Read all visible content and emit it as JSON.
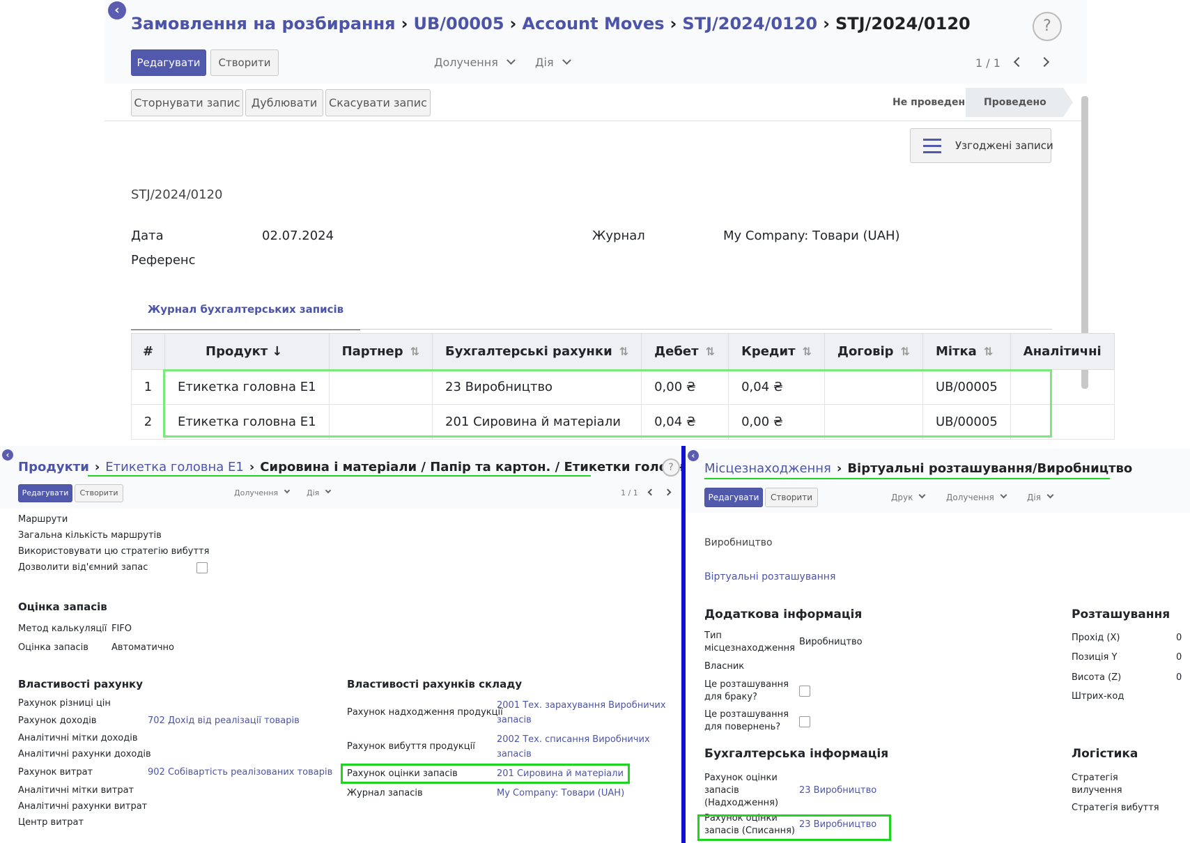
{
  "top": {
    "breadcrumb": [
      "Замовлення на розбирання",
      "UB/00005",
      "Account Moves",
      "STJ/2024/0120"
    ],
    "current": "STJ/2024/0120",
    "edit_btn": "Редагувати",
    "create_btn": "Створити",
    "attach_dd": "Долучення",
    "action_dd": "Дія",
    "pager": "1 / 1",
    "help": "?",
    "reverse_btn": "Сторнувати запис",
    "duplicate_btn": "Дублювати",
    "cancel_btn": "Скасувати запис",
    "stage_draft": "Не проведено",
    "stage_posted": "Проведено",
    "smart_btn": "Узгоджені записи",
    "record_name": "STJ/2024/0120",
    "date_label": "Дата",
    "date_value": "02.07.2024",
    "journal_label": "Журнал",
    "journal_value": "My Company: Товари (UAH)",
    "ref_label": "Референс",
    "tab_label": "Журнал бухгалтерських записів",
    "columns": [
      "#",
      "Продукт",
      "Партнер",
      "Бухгалтерські рахунки",
      "Дебет",
      "Кредит",
      "Договір",
      "Мітка",
      "Аналітичні"
    ],
    "rows": [
      {
        "n": "1",
        "product": "Етикетка головна E1",
        "partner": "",
        "account": "23 Виробництво",
        "debit": "0,00 ₴",
        "credit": "0,04 ₴",
        "contract": "",
        "label": "UB/00005",
        "analytic": ""
      },
      {
        "n": "2",
        "product": "Етикетка головна E1",
        "partner": "",
        "account": "201 Сировина й матеріали",
        "debit": "0,04 ₴",
        "credit": "0,00 ₴",
        "contract": "",
        "label": "UB/00005",
        "analytic": ""
      }
    ]
  },
  "left": {
    "crumb_root": "Продукти",
    "crumb_product": "Етикетка головна E1",
    "crumb_cat": "Сировина і матеріали / Папір та картон. / Етикетки головні",
    "edit_btn": "Редагувати",
    "create_btn": "Створити",
    "attach_dd": "Долучення",
    "action_dd": "Дія",
    "pager": "1 / 1",
    "help": "?",
    "routes": "Маршрути",
    "routes_count": "Загальна кількість маршрутів",
    "use_strategy": "Використовувати цю стратегію вибуття",
    "allow_negative": "Дозволити від'ємний запас",
    "valuation_title": "Оцінка запасів",
    "cost_method_label": "Метод калькуляції",
    "cost_method_value": "FIFO",
    "valuation_label": "Оцінка запасів",
    "valuation_value": "Автоматично",
    "acc_props_title": "Властивості рахунку",
    "price_diff": "Рахунок різниці цін",
    "income_acc": "Рахунок доходів",
    "income_acc_value": "702 Дохід від реалізації товарів",
    "income_tags": "Аналітичні мітки доходів",
    "income_analytic": "Аналітичні рахунки доходів",
    "expense_acc": "Рахунок витрат",
    "expense_acc_value": "902 Собівартість реалізованих товарів",
    "expense_tags": "Аналітичні мітки витрат",
    "expense_analytic": "Аналітичні рахунки витрат",
    "cost_center": "Центр витрат",
    "stock_props_title": "Властивості рахунків складу",
    "in_acc": "Рахунок надходження продукції",
    "in_acc_value1": "2001 Тех. зарахування Виробничих",
    "in_acc_value2": "запасів",
    "out_acc": "Рахунок вибуття продукції",
    "out_acc_value1": "2002 Тех. списання Виробничих",
    "out_acc_value2": "запасів",
    "val_acc": "Рахунок оцінки запасів",
    "val_acc_value": "201 Сировина й матеріали",
    "stock_journal": "Журнал запасів",
    "stock_journal_value": "My Company: Товари (UAH)"
  },
  "right": {
    "crumb_root": "Місцезнаходження",
    "crumb_current": "Віртуальні розташування/Виробництво",
    "edit_btn": "Редагувати",
    "create_btn": "Створити",
    "print_dd": "Друк",
    "attach_dd": "Долучення",
    "action_dd": "Дія",
    "name": "Виробництво",
    "parent": "Віртуальні розташування",
    "extra_title": "Додаткова інформація",
    "type_label1": "Тип",
    "type_label2": "місцезнаходження",
    "type_value": "Виробництво",
    "owner": "Власник",
    "scrap1": "Це розташування",
    "scrap2": "для браку?",
    "return1": "Це розташування",
    "return2": "для повернень?",
    "acc_title": "Бухгалтерська інформація",
    "in_label1": "Рахунок оцінки",
    "in_label2": "запасів",
    "in_label3": "(Надходження)",
    "in_value": "23 Виробництво",
    "out_label1": "Рахунок оцінки",
    "out_label2": "запасів (Списання)",
    "out_value": "23 Виробництво",
    "loc_title": "Розташування",
    "x_label": "Прохід (X)",
    "x_value": "0",
    "y_label": "Позиція Y",
    "y_value": "0",
    "z_label": "Висота (Z)",
    "z_value": "0",
    "barcode": "Штрих-код",
    "logistics_title": "Логістика",
    "removal1": "Стратегія",
    "removal2": "вилучення",
    "out_strategy": "Стратегія вибуття"
  },
  "colors": {
    "accent": "#5159ad",
    "highlight": "#1fd41f",
    "divider": "#1010d0"
  }
}
